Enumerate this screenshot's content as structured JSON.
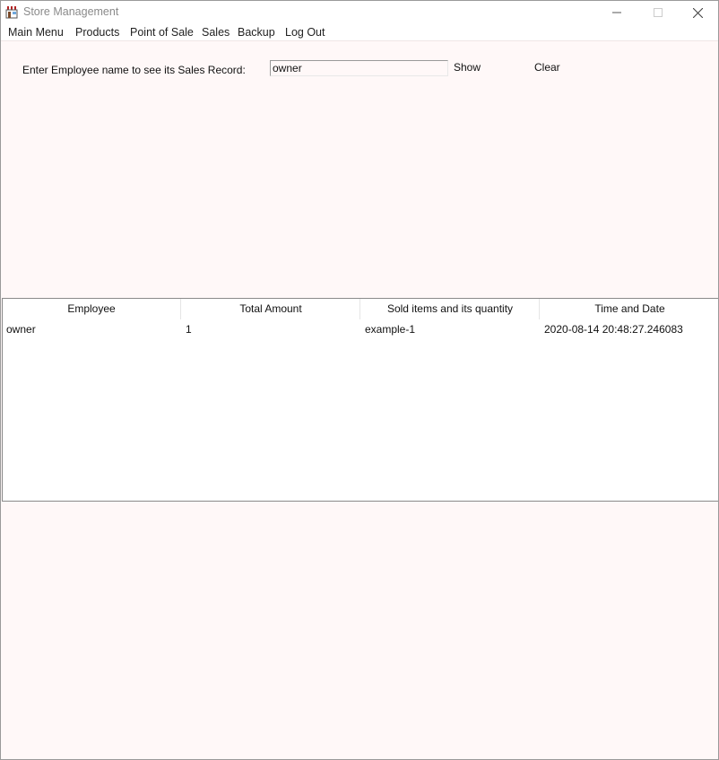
{
  "window": {
    "title": "Store Management",
    "controls": {
      "minimize": "—",
      "maximize": "☐",
      "close": "✕"
    }
  },
  "menu": [
    "Main Menu",
    "Products",
    "Point of Sale",
    "Sales",
    "Backup",
    "Log Out"
  ],
  "search": {
    "label": "Enter Employee name to see its Sales Record:",
    "value": "owner",
    "show_label": "Show",
    "clear_label": "Clear"
  },
  "table": {
    "columns": [
      "Employee",
      "Total Amount",
      "Sold items and its quantity",
      "Time and Date"
    ],
    "rows": [
      [
        "owner",
        "1",
        "example-1",
        "2020-08-14 20:48:27.246083"
      ]
    ]
  },
  "icons": {
    "app": "store-awning-icon"
  },
  "colors": {
    "background": "#fff8f8",
    "accent": "#b22222"
  }
}
